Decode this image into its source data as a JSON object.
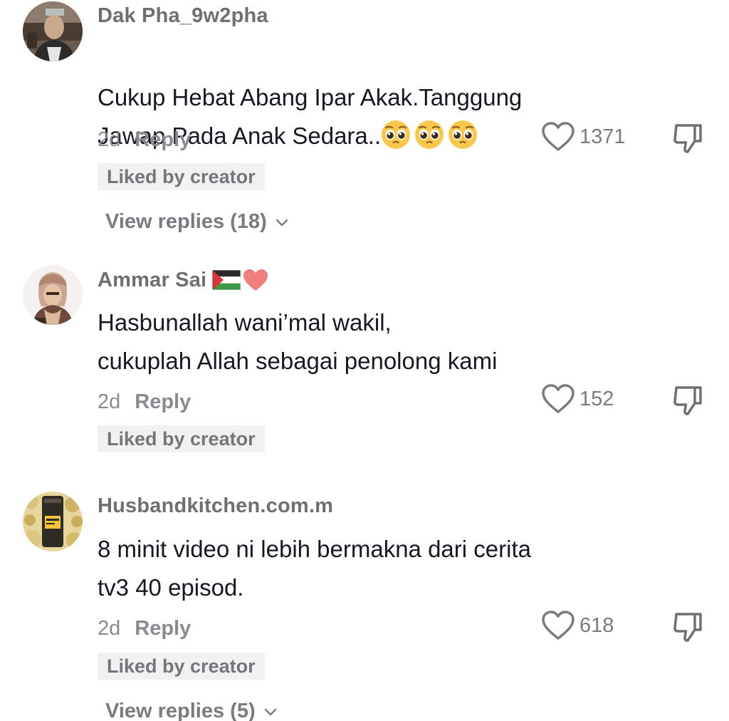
{
  "comments": [
    {
      "username": "Dak Pha_9w2pha",
      "text": "Cukup Hebat Abang Ipar Akak.Tanggung\nJawap Pada Anak Sedara..",
      "emojis": [
        "pleading-face",
        "pleading-face",
        "pleading-face"
      ],
      "age": "2d",
      "reply_label": "Reply",
      "likes": "1371",
      "liked_by_creator": "Liked by creator",
      "view_replies": "View replies (18)"
    },
    {
      "username": "Ammar Sai",
      "username_emojis": [
        "palestine-flag",
        "red-heart"
      ],
      "text": "Hasbunallah wani’mal wakil,\ncukuplah Allah sebagai penolong kami",
      "age": "2d",
      "reply_label": "Reply",
      "likes": "152",
      "liked_by_creator": "Liked by creator"
    },
    {
      "username": "Husbandkitchen.com.m",
      "text": "8 minit video ni lebih bermakna dari cerita\ntv3 40 episod.",
      "age": "2d",
      "reply_label": "Reply",
      "likes": "618",
      "liked_by_creator": "Liked by creator",
      "view_replies": "View replies (5)"
    }
  ],
  "icons": {
    "like": "heart-outline-icon",
    "dislike": "thumbs-down-icon",
    "expand": "chevron-down-icon"
  },
  "colors": {
    "username": "#6f6f73",
    "comment_text": "#161823",
    "meta": "#8a8b91",
    "badge_bg": "#f1f1f2"
  }
}
